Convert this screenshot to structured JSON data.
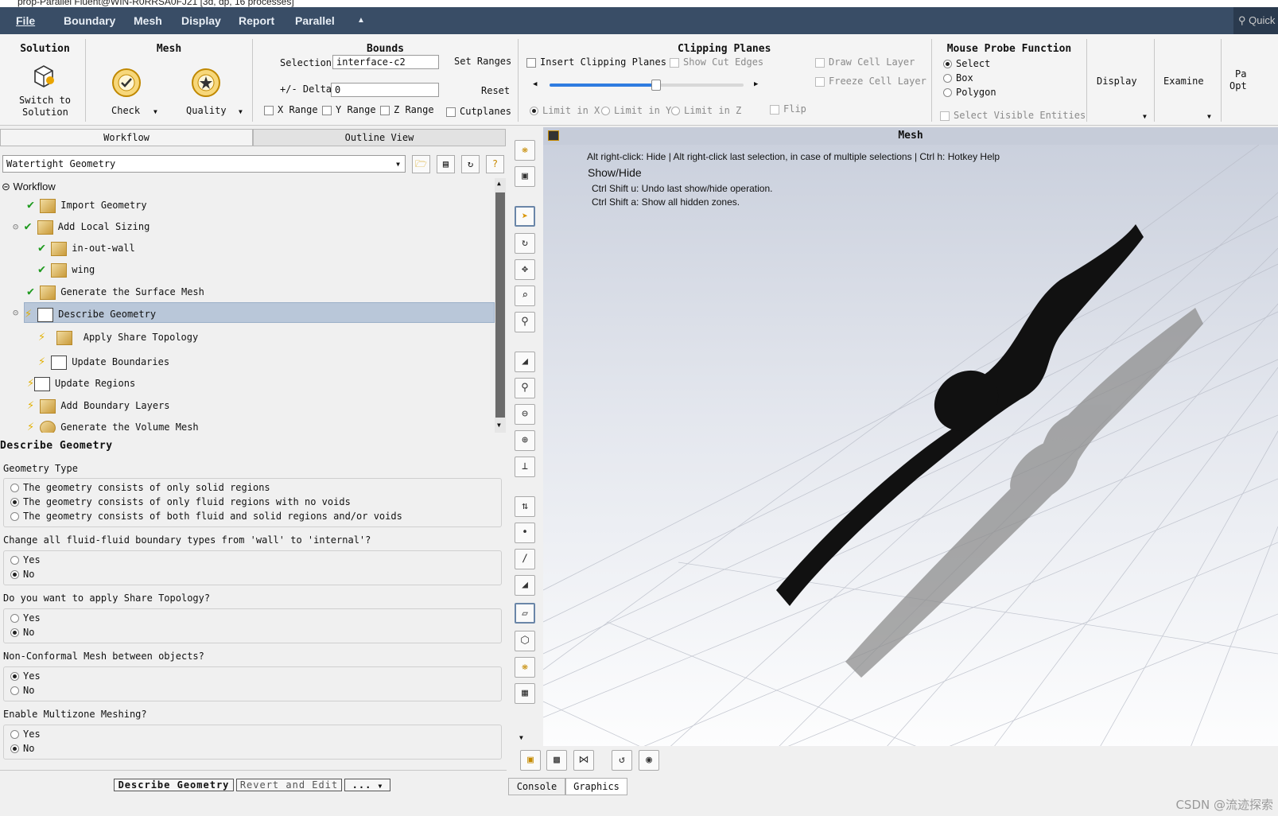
{
  "window": {
    "title": "prop-Parallel Fluent@WIN-R0RRSA0FJ21 [3d, dp, 16 processes]"
  },
  "menu": {
    "items": [
      "File",
      "Boundary",
      "Mesh",
      "Display",
      "Report",
      "Parallel"
    ],
    "quick": "Quick"
  },
  "ribbon": {
    "solution": {
      "title": "Solution",
      "switch_label_1": "Switch to",
      "switch_label_2": "Solution"
    },
    "mesh": {
      "title": "Mesh",
      "check": "Check",
      "quality": "Quality"
    },
    "bounds": {
      "title": "Bounds",
      "selection_label": "Selection",
      "selection_value": "interface-c2",
      "set_ranges": "Set Ranges",
      "delta_label": "+/- Delta",
      "delta_value": "0",
      "reset": "Reset",
      "x_range": "X Range",
      "y_range": "Y Range",
      "z_range": "Z Range",
      "cutplanes": "Cutplanes"
    },
    "clipping": {
      "title": "Clipping Planes",
      "insert": "Insert Clipping Planes",
      "show_cut": "Show Cut Edges",
      "draw_cell": "Draw Cell Layer",
      "freeze_cell": "Freeze Cell Layer",
      "limit_x": "Limit in X",
      "limit_y": "Limit in Y",
      "limit_z": "Limit in Z",
      "flip": "Flip",
      "slider_value": 0.55
    },
    "probe": {
      "title": "Mouse Probe Function",
      "select": "Select",
      "box": "Box",
      "polygon": "Polygon",
      "visible": "Select Visible Entities"
    },
    "display": "Display",
    "examine": "Examine",
    "pa_opt_1": "Pa",
    "pa_opt_2": "Opt"
  },
  "left": {
    "tabs": [
      "Workflow",
      "Outline View"
    ],
    "workflow_select": "Watertight Geometry",
    "tree": {
      "root": "Workflow",
      "items": [
        "Import Geometry",
        "Add Local Sizing",
        "in-out-wall",
        "wing",
        "Generate the Surface Mesh",
        "Describe Geometry",
        "Apply Share Topology",
        "Update Boundaries",
        "Update Regions",
        "Add Boundary Layers",
        "Generate the Volume Mesh"
      ]
    },
    "task": {
      "title": "Describe Geometry",
      "geom_type_label": "Geometry Type",
      "geom_opts": [
        "The geometry consists of only solid regions",
        "The geometry consists of only fluid regions with no voids",
        "The geometry consists of both fluid and solid regions and/or voids"
      ],
      "q1": "Change all fluid-fluid boundary types from 'wall' to 'internal'?",
      "q2": "Do you want to apply Share Topology?",
      "q3": "Non-Conformal Mesh between objects?",
      "q4": "Enable Multizone Meshing?",
      "yes": "Yes",
      "no": "No"
    },
    "buttons": {
      "describe": "Describe Geometry",
      "revert": "Revert and Edit",
      "more": "..."
    }
  },
  "graphics": {
    "title": "Mesh",
    "help_line": "Alt right-click: Hide | Alt right-click last selection, in case of multiple selections | Ctrl h: Hotkey Help",
    "show_hide": "Show/Hide",
    "undo": "Ctrl Shift u: Undo last show/hide operation.",
    "show_all": "Ctrl Shift a: Show all hidden zones."
  },
  "bottom_tabs": [
    "Console",
    "Graphics"
  ],
  "watermark": "CSDN @流迹探索"
}
